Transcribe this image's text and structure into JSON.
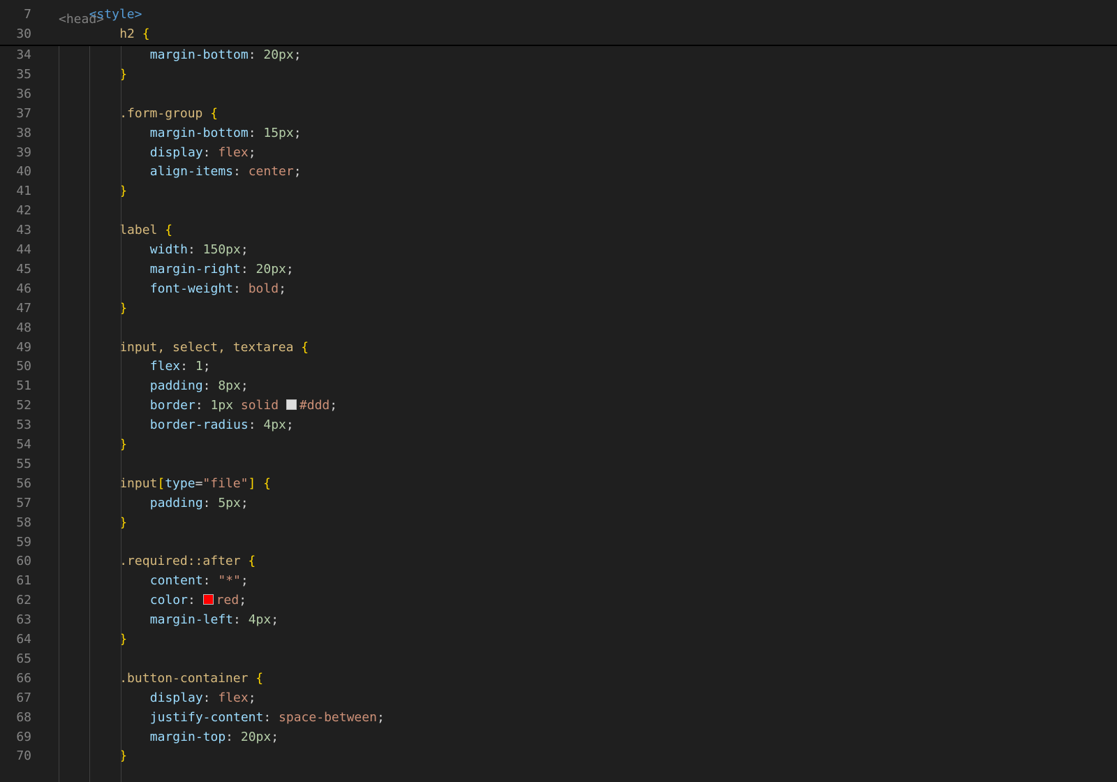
{
  "editor": {
    "top_partial_fragment": "<head>",
    "sticky_lines": [
      {
        "no": "7",
        "parts": [
          [
            "<style>",
            "tag"
          ]
        ]
      },
      {
        "no": "30",
        "parts": [
          [
            "h2",
            "sel"
          ],
          [
            " {",
            "br"
          ]
        ]
      }
    ],
    "lines": [
      {
        "no": "34",
        "parts": [
          [
            "margin-bottom",
            "prop"
          ],
          [
            ": ",
            "p"
          ],
          [
            "20px",
            "num"
          ],
          [
            ";",
            "p"
          ]
        ]
      },
      {
        "no": "35",
        "parts": [
          [
            "}",
            "br"
          ]
        ]
      },
      {
        "no": "36",
        "parts": []
      },
      {
        "no": "37",
        "parts": [
          [
            ".form-group",
            "sel"
          ],
          [
            " {",
            "br"
          ]
        ]
      },
      {
        "no": "38",
        "parts": [
          [
            "margin-bottom",
            "prop"
          ],
          [
            ": ",
            "p"
          ],
          [
            "15px",
            "num"
          ],
          [
            ";",
            "p"
          ]
        ]
      },
      {
        "no": "39",
        "parts": [
          [
            "display",
            "prop"
          ],
          [
            ": ",
            "p"
          ],
          [
            "flex",
            "val"
          ],
          [
            ";",
            "p"
          ]
        ]
      },
      {
        "no": "40",
        "parts": [
          [
            "align-items",
            "prop"
          ],
          [
            ": ",
            "p"
          ],
          [
            "center",
            "val"
          ],
          [
            ";",
            "p"
          ]
        ]
      },
      {
        "no": "41",
        "parts": [
          [
            "}",
            "br"
          ]
        ]
      },
      {
        "no": "42",
        "parts": []
      },
      {
        "no": "43",
        "parts": [
          [
            "label",
            "sel"
          ],
          [
            " {",
            "br"
          ]
        ]
      },
      {
        "no": "44",
        "parts": [
          [
            "width",
            "prop"
          ],
          [
            ": ",
            "p"
          ],
          [
            "150px",
            "num"
          ],
          [
            ";",
            "p"
          ]
        ]
      },
      {
        "no": "45",
        "parts": [
          [
            "margin-right",
            "prop"
          ],
          [
            ": ",
            "p"
          ],
          [
            "20px",
            "num"
          ],
          [
            ";",
            "p"
          ]
        ]
      },
      {
        "no": "46",
        "parts": [
          [
            "font-weight",
            "prop"
          ],
          [
            ": ",
            "p"
          ],
          [
            "bold",
            "val"
          ],
          [
            ";",
            "p"
          ]
        ]
      },
      {
        "no": "47",
        "parts": [
          [
            "}",
            "br"
          ]
        ]
      },
      {
        "no": "48",
        "parts": []
      },
      {
        "no": "49",
        "parts": [
          [
            "input, select, textarea",
            "sel"
          ],
          [
            " {",
            "br"
          ]
        ]
      },
      {
        "no": "50",
        "parts": [
          [
            "flex",
            "prop"
          ],
          [
            ": ",
            "p"
          ],
          [
            "1",
            "num"
          ],
          [
            ";",
            "p"
          ]
        ]
      },
      {
        "no": "51",
        "parts": [
          [
            "padding",
            "prop"
          ],
          [
            ": ",
            "p"
          ],
          [
            "8px",
            "num"
          ],
          [
            ";",
            "p"
          ]
        ]
      },
      {
        "no": "52",
        "parts": [
          [
            "border",
            "prop"
          ],
          [
            ": ",
            "p"
          ],
          [
            "1px",
            "num"
          ],
          [
            " ",
            "p"
          ],
          [
            "solid",
            "val"
          ],
          [
            " ",
            "p"
          ],
          [
            "#dddddd",
            "swatch"
          ],
          [
            "#ddd",
            "val"
          ],
          [
            ";",
            "p"
          ]
        ]
      },
      {
        "no": "53",
        "parts": [
          [
            "border-radius",
            "prop"
          ],
          [
            ": ",
            "p"
          ],
          [
            "4px",
            "num"
          ],
          [
            ";",
            "p"
          ]
        ]
      },
      {
        "no": "54",
        "parts": [
          [
            "}",
            "br"
          ]
        ]
      },
      {
        "no": "55",
        "parts": []
      },
      {
        "no": "56",
        "parts": [
          [
            "input",
            "sel"
          ],
          [
            "[",
            "br"
          ],
          [
            "type",
            "prop"
          ],
          [
            "=",
            "p"
          ],
          [
            "\"file\"",
            "val"
          ],
          [
            "]",
            "br"
          ],
          [
            " {",
            "br"
          ]
        ]
      },
      {
        "no": "57",
        "parts": [
          [
            "padding",
            "prop"
          ],
          [
            ": ",
            "p"
          ],
          [
            "5px",
            "num"
          ],
          [
            ";",
            "p"
          ]
        ]
      },
      {
        "no": "58",
        "parts": [
          [
            "}",
            "br"
          ]
        ]
      },
      {
        "no": "59",
        "parts": []
      },
      {
        "no": "60",
        "parts": [
          [
            ".required::after",
            "sel"
          ],
          [
            " {",
            "br"
          ]
        ]
      },
      {
        "no": "61",
        "parts": [
          [
            "content",
            "prop"
          ],
          [
            ": ",
            "p"
          ],
          [
            "\"*\"",
            "val"
          ],
          [
            ";",
            "p"
          ]
        ]
      },
      {
        "no": "62",
        "parts": [
          [
            "color",
            "prop"
          ],
          [
            ": ",
            "p"
          ],
          [
            "#ff0000",
            "swatch"
          ],
          [
            "red",
            "val"
          ],
          [
            ";",
            "p"
          ]
        ]
      },
      {
        "no": "63",
        "parts": [
          [
            "margin-left",
            "prop"
          ],
          [
            ": ",
            "p"
          ],
          [
            "4px",
            "num"
          ],
          [
            ";",
            "p"
          ]
        ]
      },
      {
        "no": "64",
        "parts": [
          [
            "}",
            "br"
          ]
        ]
      },
      {
        "no": "65",
        "parts": []
      },
      {
        "no": "66",
        "parts": [
          [
            ".button-container",
            "sel"
          ],
          [
            " {",
            "br"
          ]
        ]
      },
      {
        "no": "67",
        "parts": [
          [
            "display",
            "prop"
          ],
          [
            ": ",
            "p"
          ],
          [
            "flex",
            "val"
          ],
          [
            ";",
            "p"
          ]
        ]
      },
      {
        "no": "68",
        "parts": [
          [
            "justify-content",
            "prop"
          ],
          [
            ": ",
            "p"
          ],
          [
            "space-between",
            "val"
          ],
          [
            ";",
            "p"
          ]
        ]
      },
      {
        "no": "69",
        "parts": [
          [
            "margin-top",
            "prop"
          ],
          [
            ": ",
            "p"
          ],
          [
            "20px",
            "num"
          ],
          [
            ";",
            "p"
          ]
        ]
      },
      {
        "no": "70",
        "parts": [
          [
            "}",
            "br"
          ]
        ]
      }
    ]
  },
  "colors": {
    "background": "#1f1f1f",
    "line_number": "#858585",
    "tag": "#569cd6",
    "selector": "#d7ba7d",
    "bracket": "#ffd700",
    "property": "#9cdcfe",
    "number": "#b5cea8",
    "string_value": "#ce9178"
  }
}
